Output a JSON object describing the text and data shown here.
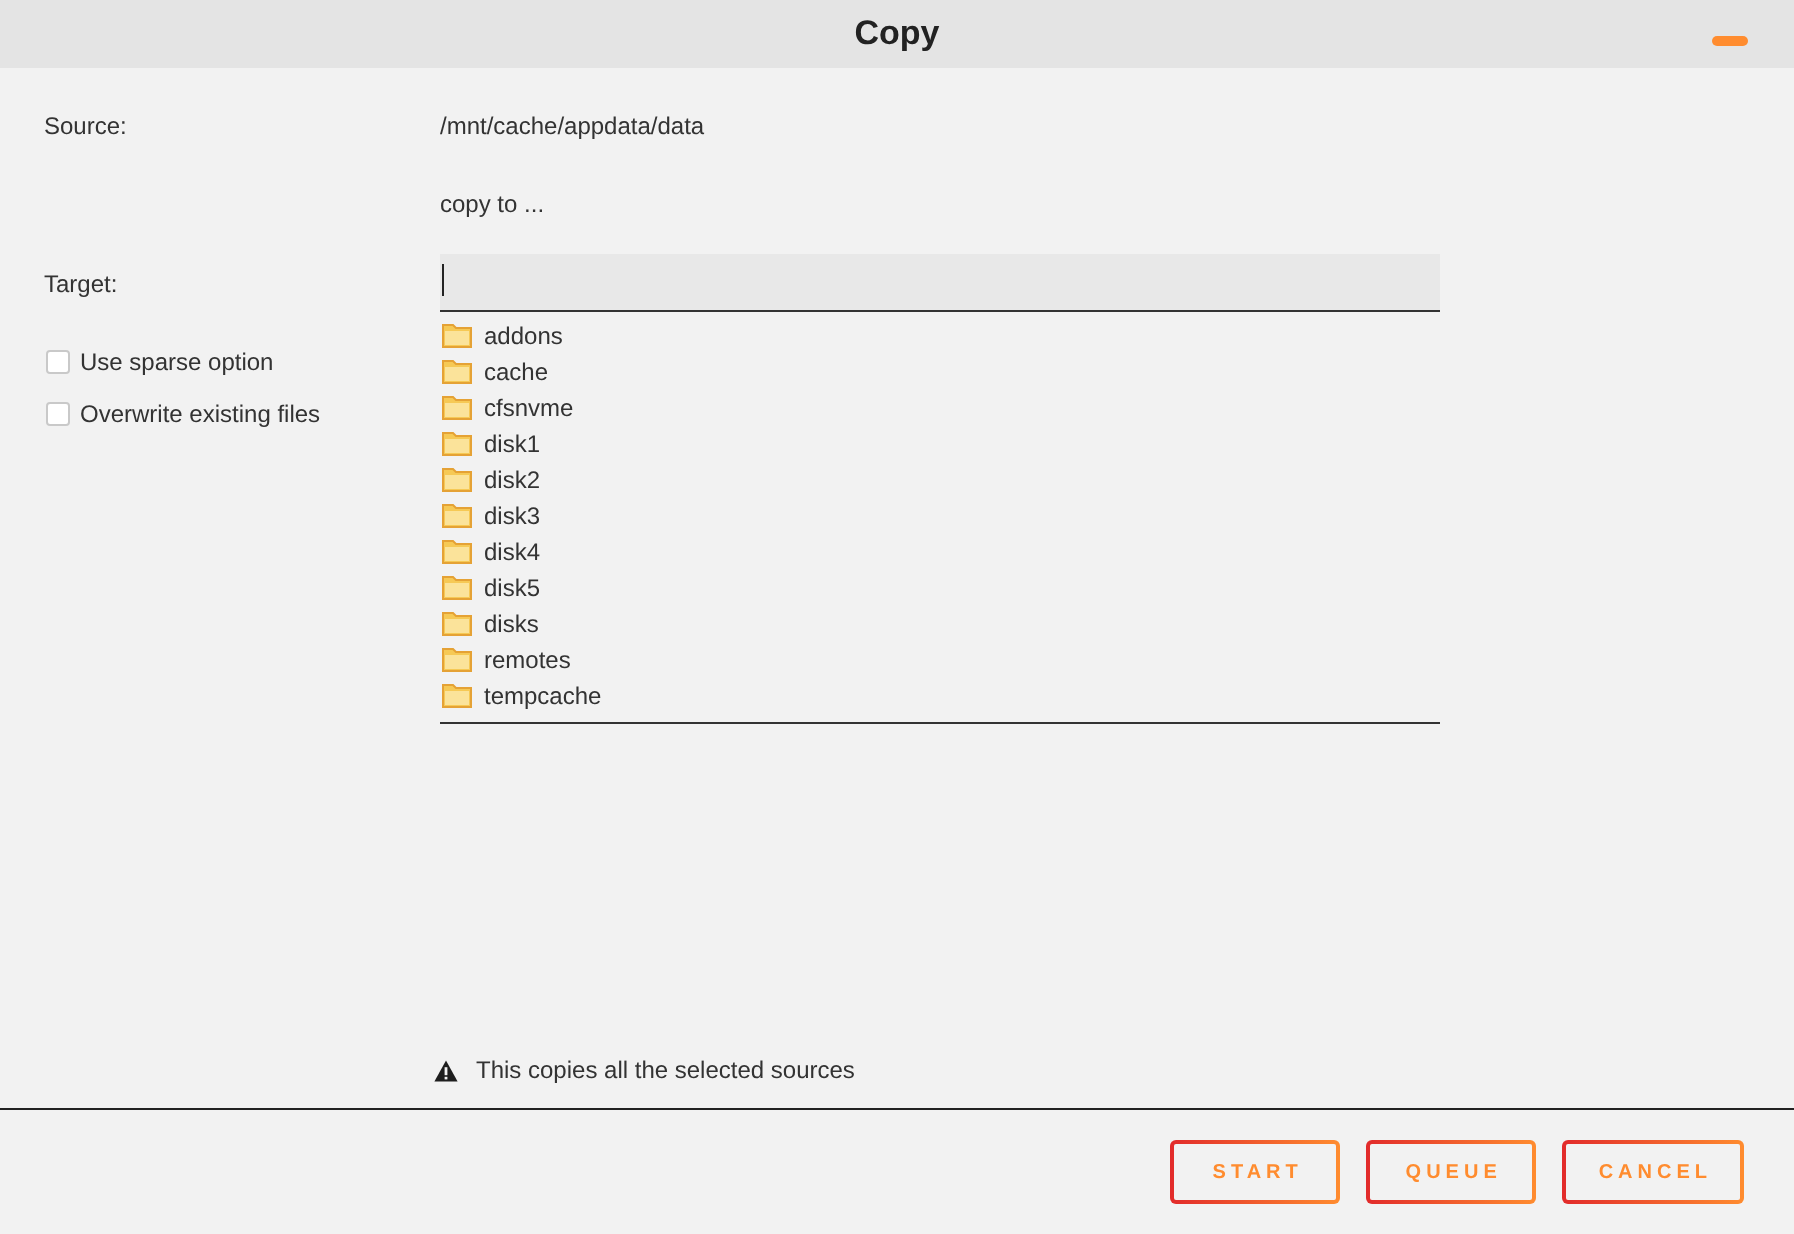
{
  "window": {
    "title": "Copy"
  },
  "form": {
    "source": {
      "label": "Source:",
      "value": "/mnt/cache/appdata/data"
    },
    "hint": "copy to ...",
    "target": {
      "label": "Target:"
    },
    "options": [
      {
        "label": "Use sparse option",
        "checked": false
      },
      {
        "label": "Overwrite existing files",
        "checked": false
      }
    ],
    "folders": [
      "addons",
      "cache",
      "cfsnvme",
      "disk1",
      "disk2",
      "disk3",
      "disk4",
      "disk5",
      "disks",
      "remotes",
      "tempcache"
    ]
  },
  "notice": {
    "text": "This copies all the selected sources"
  },
  "buttons": [
    "START",
    "QUEUE",
    "CANCEL"
  ]
}
